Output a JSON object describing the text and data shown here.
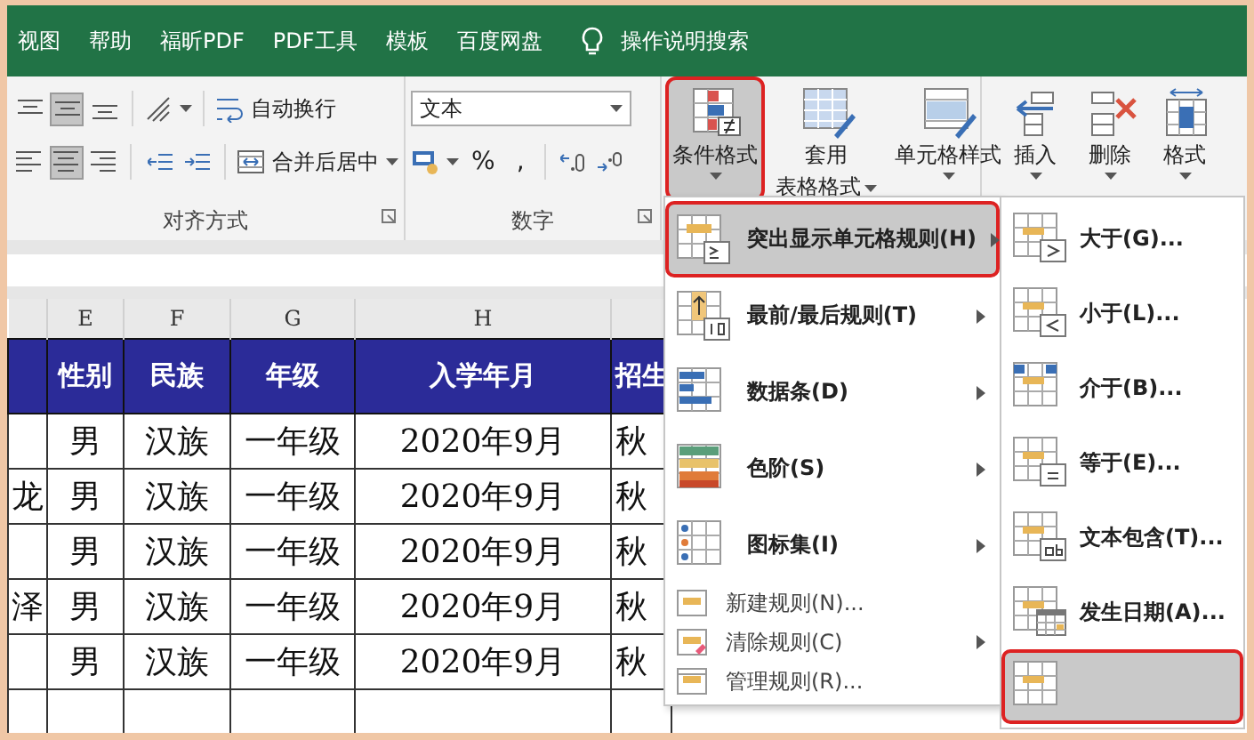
{
  "tabs": [
    "视图",
    "帮助",
    "福昕PDF",
    "PDF工具",
    "模板",
    "百度网盘"
  ],
  "tell_me": {
    "label": "操作说明搜索"
  },
  "ribbon": {
    "alignment": {
      "label": "对齐方式",
      "vertical": [
        {
          "selected": false
        },
        {
          "selected": true
        },
        {
          "selected": false
        }
      ],
      "horizontal": [
        {
          "selected": false
        },
        {
          "selected": true
        },
        {
          "selected": false
        }
      ],
      "wrap_text": "自动换行",
      "merge_center": "合并后居中"
    },
    "number": {
      "label": "数字",
      "format": "文本",
      "percent": "%",
      "comma": ","
    },
    "styles": [
      {
        "lines": [
          "条件格式"
        ],
        "selected": true,
        "annotated": true
      },
      {
        "lines": [
          "套用",
          "表格格式"
        ],
        "selected": false,
        "annotated": false
      },
      {
        "lines": [
          "单元格样式"
        ],
        "selected": false,
        "annotated": false
      }
    ],
    "cells": [
      {
        "label": "插入"
      },
      {
        "label": "删除"
      },
      {
        "label": "格式"
      }
    ]
  },
  "sheet": {
    "columns": [
      {},
      {
        "letter": "E",
        "header": "性别"
      },
      {
        "letter": "F",
        "header": "民族"
      },
      {
        "letter": "G",
        "header": "年级"
      },
      {
        "letter": "H",
        "header": "入学年月"
      },
      {
        "header": "招生"
      }
    ],
    "rows": [
      [
        {},
        {
          "text": "男"
        },
        {
          "text": "汉族"
        },
        {
          "text": "一年级"
        },
        {
          "text": "2020年9月"
        },
        {
          "text": "秋"
        }
      ],
      [
        {
          "text": "龙"
        },
        {
          "text": "男"
        },
        {
          "text": "汉族"
        },
        {
          "text": "一年级"
        },
        {
          "text": "2020年9月"
        },
        {
          "text": "秋"
        }
      ],
      [
        {},
        {
          "text": "男"
        },
        {
          "text": "汉族"
        },
        {
          "text": "一年级"
        },
        {
          "text": "2020年9月"
        },
        {
          "text": "秋"
        }
      ],
      [
        {
          "text": "泽"
        },
        {
          "text": "男"
        },
        {
          "text": "汉族"
        },
        {
          "text": "一年级"
        },
        {
          "text": "2020年9月"
        },
        {
          "text": "秋"
        }
      ],
      [
        {},
        {
          "text": "男"
        },
        {
          "text": "汉族"
        },
        {
          "text": "一年级"
        },
        {
          "text": "2020年9月"
        },
        {
          "text": "秋"
        }
      ]
    ]
  },
  "menu": {
    "items": [
      {
        "kind": "large",
        "label": "突出显示单元格规则(H)",
        "submenu": true,
        "selected": true,
        "annotated": true
      },
      {
        "kind": "large",
        "label": "最前/最后规则(T)",
        "submenu": true,
        "selected": false,
        "annotated": false
      },
      {
        "kind": "large",
        "label": "数据条(D)",
        "submenu": true,
        "selected": false,
        "annotated": false
      },
      {
        "kind": "large",
        "label": "色阶(S)",
        "submenu": true,
        "selected": false,
        "annotated": false
      },
      {
        "kind": "large",
        "label": "图标集(I)",
        "submenu": true,
        "selected": false,
        "annotated": false
      },
      {
        "kind": "small",
        "label": "新建规则(N)...",
        "submenu": false,
        "selected": false,
        "annotated": false
      },
      {
        "kind": "small",
        "label": "清除规则(C)",
        "submenu": true,
        "selected": false,
        "annotated": false
      },
      {
        "kind": "small",
        "label": "管理规则(R)...",
        "submenu": false,
        "selected": false,
        "annotated": false
      }
    ]
  },
  "submenu": {
    "items": [
      {
        "label": "大于(G)...",
        "selected": false,
        "annotated": false
      },
      {
        "label": "小于(L)...",
        "selected": false,
        "annotated": false
      },
      {
        "label": "介于(B)...",
        "selected": false,
        "annotated": false
      },
      {
        "label": "等于(E)...",
        "selected": false,
        "annotated": false
      },
      {
        "label": "文本包含(T)...",
        "selected": false,
        "annotated": false
      },
      {
        "label": "发生日期(A)...",
        "selected": false,
        "annotated": false
      },
      {
        "selected": true,
        "annotated": true
      }
    ]
  }
}
